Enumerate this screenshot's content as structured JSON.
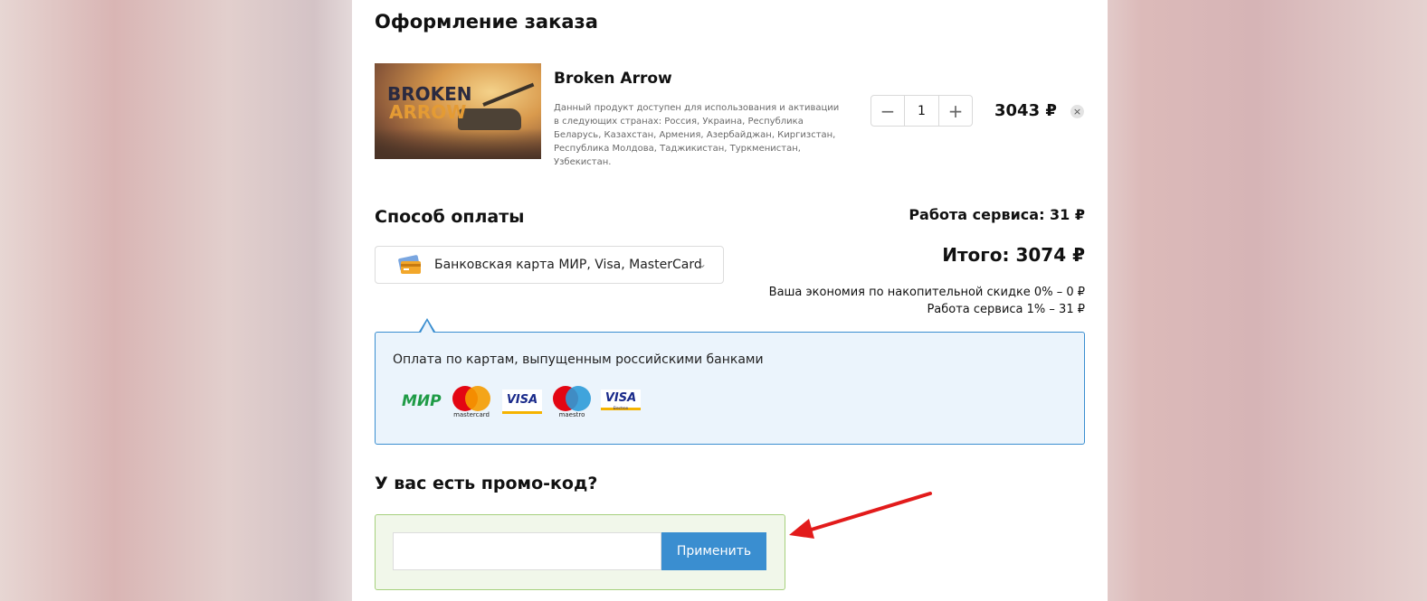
{
  "page": {
    "title": "Оформление заказа"
  },
  "product": {
    "name": "Broken Arrow",
    "image_text_line1": "BROKEN",
    "image_text_line2": "ARROW",
    "description": "Данный продукт доступен для использования и активации в следующих странах: Россия, Украина, Республика Беларусь, Казахстан, Армения, Азербайджан, Киргизстан, Республика Молдова, Таджикистан, Туркменистан, Узбекистан.",
    "quantity": "1",
    "minus": "−",
    "plus": "+",
    "price": "3043 ₽",
    "remove": "×"
  },
  "payment": {
    "title": "Способ оплаты",
    "selected_method": "Банковская карта МИР, Visa, MasterCard",
    "note": "Оплата по картам, выпущенным российскими банками",
    "logos": {
      "mir": "МИР",
      "mastercard": "mastercard",
      "visa": "VISA",
      "maestro": "maestro",
      "visa_electron": "VISA",
      "electron": "Electron"
    }
  },
  "summary": {
    "service_fee": "Работа сервиса: 31 ₽",
    "total_label": "Итого:",
    "total_value": "3074 ₽",
    "savings": "Ваша экономия по накопительной скидке 0% – 0 ₽",
    "service_pct": "Работа сервиса 1% – 31 ₽"
  },
  "promo": {
    "title": "У вас есть промо-код?",
    "input_value": "",
    "apply_label": "Применить"
  },
  "colors": {
    "accent": "#3a8ed0",
    "promo_border": "#a6d07d",
    "annotation_arrow": "#e21b1b"
  }
}
